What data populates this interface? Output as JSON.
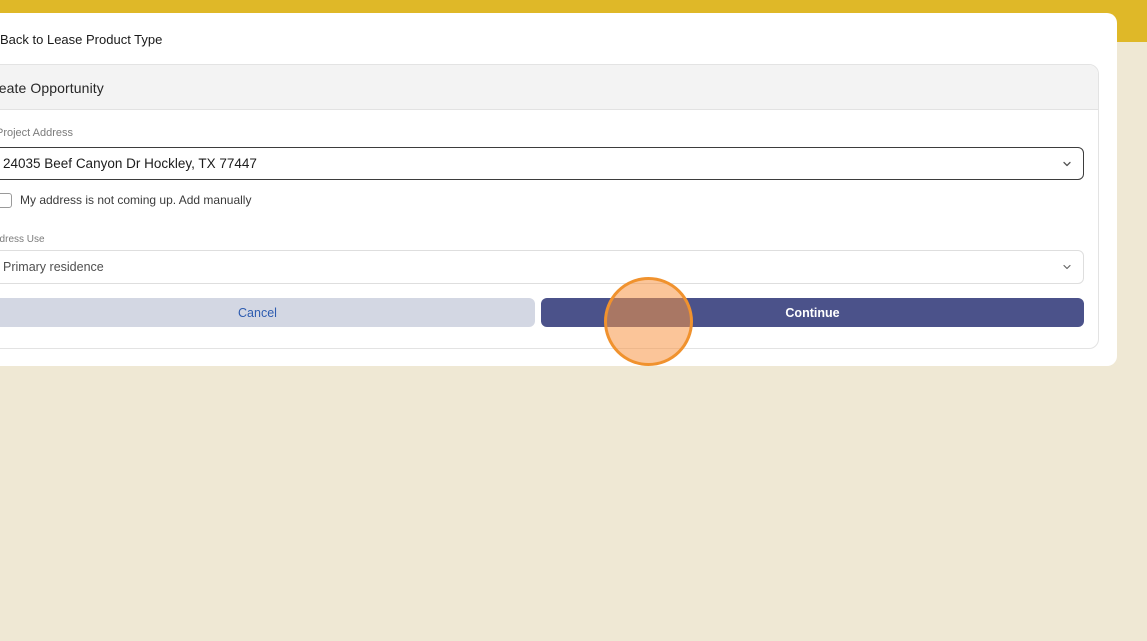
{
  "header": {
    "accent_color": "#dfb828"
  },
  "nav": {
    "back_label": "Back to Lease Product Type"
  },
  "panel": {
    "title": "reate Opportunity"
  },
  "project_address": {
    "label": "Project Address",
    "value": "24035 Beef Canyon Dr Hockley, TX 77447",
    "icon": "chevron-down-icon"
  },
  "manual_address": {
    "checked": false,
    "label": "My address is not coming up. Add manually"
  },
  "address_use": {
    "label": "ddress Use",
    "value": "Primary residence",
    "icon": "chevron-down-icon"
  },
  "actions": {
    "cancel_label": "Cancel",
    "continue_label": "Continue"
  },
  "colors": {
    "background": "#efe8d4",
    "continue_button": "#4b528a",
    "cancel_button": "#d3d7e3",
    "click_indicator": "#f0922e"
  }
}
